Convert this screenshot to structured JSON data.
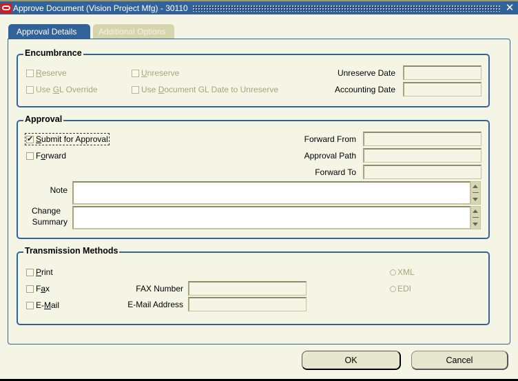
{
  "window": {
    "title": "Approve Document (Vision Project Mfg) - 30110",
    "icon": "oracle-icon",
    "close_icon": "close-icon"
  },
  "tabs": [
    {
      "label": "Approval Details",
      "active": true
    },
    {
      "label": "Additional Options",
      "active": false
    }
  ],
  "encumbrance": {
    "title": "Encumbrance",
    "reserve": {
      "pre": "",
      "key": "R",
      "post": "eserve",
      "checked": false,
      "enabled": false
    },
    "unreserve": {
      "pre": "",
      "key": "U",
      "post": "nreserve",
      "checked": false,
      "enabled": false
    },
    "use_gl_override": {
      "pre": "Use ",
      "key": "G",
      "post": "L Override",
      "checked": false,
      "enabled": false
    },
    "use_doc_gl_date": {
      "pre": "Use ",
      "key": "D",
      "post": "ocument GL Date to Unreserve",
      "checked": false,
      "enabled": false
    },
    "unreserve_date_label": "Unreserve Date",
    "unreserve_date_value": "",
    "accounting_date_label": "Accounting Date",
    "accounting_date_value": ""
  },
  "approval": {
    "title": "Approval",
    "submit": {
      "pre": "",
      "key": "S",
      "post": "ubmit for Approval",
      "checked": true
    },
    "forward": {
      "pre": "F",
      "key": "o",
      "post": "rward",
      "checked": false
    },
    "forward_from_label": "Forward From",
    "forward_from_value": "",
    "approval_path_label": "Approval Path",
    "approval_path_value": "",
    "forward_to_label": "Forward To",
    "forward_to_value": "",
    "note_label": "Note",
    "note_value": "",
    "change_summary_label_1": "Change",
    "change_summary_label_2": "Summary",
    "change_summary_value": ""
  },
  "transmission": {
    "title": "Transmission Methods",
    "print": {
      "pre": "",
      "key": "P",
      "post": "rint",
      "checked": false
    },
    "fax": {
      "pre": "F",
      "key": "a",
      "post": "x",
      "checked": false
    },
    "email": {
      "pre": "E-",
      "key": "M",
      "post": "ail",
      "checked": false
    },
    "fax_number_label": "FAX Number",
    "fax_number_value": "",
    "email_address_label": "E-Mail Address",
    "email_address_value": "",
    "xml_label": "XML",
    "edi_label": "EDI"
  },
  "buttons": {
    "ok": "OK",
    "cancel": "Cancel"
  }
}
